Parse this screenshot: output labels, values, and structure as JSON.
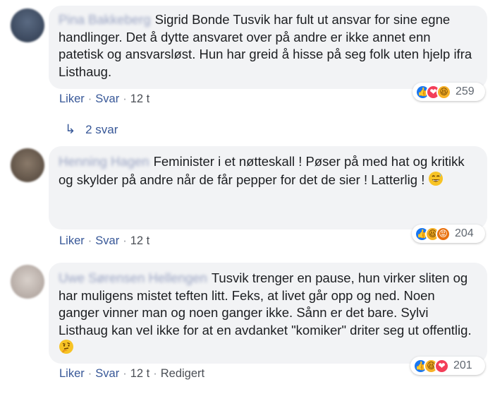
{
  "comments": [
    {
      "author": "Pina Bakkeberg",
      "text": "Sigrid Bonde Tusvik har fult ut ansvar for sine egne handlinger. Det å dytte ansvaret over på andre er ikke annet enn patetisk og ansvarsløst. Hun har greid å hisse på seg folk uten hjelp ifra Listhaug.",
      "reactions": [
        "like",
        "love",
        "haha"
      ],
      "reaction_count": "259",
      "like_label": "Liker",
      "reply_label": "Svar",
      "time": "12 t",
      "edited": ""
    },
    {
      "author": "Henning Hagen",
      "text": "Feminister i et nøtteskall ! Pøser på med hat og kritikk og skylder på andre når de får pepper for det de sier ! Latterlig !",
      "emoji": "grinning-sweat",
      "reactions": [
        "like",
        "haha",
        "angry"
      ],
      "reaction_count": "204",
      "like_label": "Liker",
      "reply_label": "Svar",
      "time": "12 t",
      "edited": ""
    },
    {
      "author": "Uwe Sørensen Hellengen",
      "text": "Tusvik trenger en pause, hun virker sliten og har muligens mistet teften litt. Feks, at livet går opp og ned. Noen ganger vinner man og noen ganger ikke. Sånn er det bare. Sylvi Listhaug kan vel ikke for at en avdanket \"komiker\" driter seg ut offentlig.",
      "emoji": "thinking",
      "reactions": [
        "like",
        "haha",
        "love"
      ],
      "reaction_count": "201",
      "like_label": "Liker",
      "reply_label": "Svar",
      "time": "12 t",
      "edited": "Redigert"
    }
  ],
  "replies_link": "2 svar",
  "colors": {
    "link": "#385898",
    "bubble": "#f2f3f5",
    "like": "#1877f2",
    "love": "#f33e58",
    "haha": "#f7b125",
    "angry": "#e9710f"
  }
}
